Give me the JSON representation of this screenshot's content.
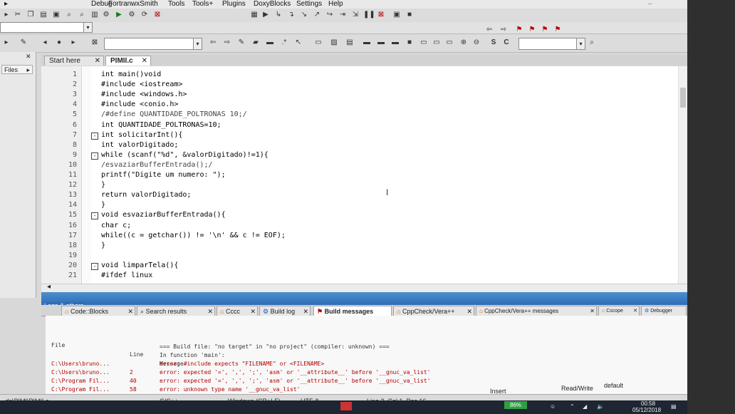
{
  "menu": [
    "Debug",
    "Fortran",
    "wxSmith",
    "Tools",
    "Tools+",
    "Plugins",
    "DoxyBlocks",
    "Settings",
    "Help"
  ],
  "left_panel": {
    "files_tab": "Files"
  },
  "editor_tabs": [
    {
      "label": "Start here",
      "active": false
    },
    {
      "label": "PIMII.c",
      "active": true
    }
  ],
  "code_lines": [
    {
      "n": "1",
      "text": "int main()void",
      "fold": ""
    },
    {
      "n": "2",
      "text": "#include <iostream>",
      "fold": ""
    },
    {
      "n": "3",
      "text": "#include <windows.h>",
      "fold": ""
    },
    {
      "n": "4",
      "text": "#include <conio.h>",
      "fold": ""
    },
    {
      "n": "5",
      "text": "/#define QUANTIDADE_POLTRONAS 10;/",
      "fold": ""
    },
    {
      "n": "6",
      "text": "int QUANTIDADE_POLTRONAS=10;",
      "fold": ""
    },
    {
      "n": "7",
      "text": "int solicitarInt(){",
      "fold": "-"
    },
    {
      "n": "8",
      "text": "int valorDigitado;",
      "fold": ""
    },
    {
      "n": "9",
      "text": "while (scanf(\"%d\", &valorDigitado)!=1){",
      "fold": "-"
    },
    {
      "n": "10",
      "text": "/esvaziarBufferEntrada();/",
      "fold": ""
    },
    {
      "n": "11",
      "text": "printf(\"Digite um numero: \");",
      "fold": ""
    },
    {
      "n": "12",
      "text": "}",
      "fold": ""
    },
    {
      "n": "13",
      "text": "return valorDigitado;",
      "fold": ""
    },
    {
      "n": "14",
      "text": "}",
      "fold": ""
    },
    {
      "n": "15",
      "text": "void esvaziarBufferEntrada(){",
      "fold": "-"
    },
    {
      "n": "16",
      "text": "char c;",
      "fold": ""
    },
    {
      "n": "17",
      "text": "while((c = getchar()) != '\\n' && c != EOF);",
      "fold": ""
    },
    {
      "n": "18",
      "text": "}",
      "fold": ""
    },
    {
      "n": "19",
      "text": "",
      "fold": ""
    },
    {
      "n": "20",
      "text": "void limparTela(){",
      "fold": "-"
    },
    {
      "n": "21",
      "text": "#ifdef linux",
      "fold": ""
    }
  ],
  "logs": {
    "title": "Logs & others",
    "tabs": [
      {
        "label": "Code::Blocks",
        "active": false
      },
      {
        "label": "Search results",
        "active": false
      },
      {
        "label": "Cccc",
        "active": false
      },
      {
        "label": "Build log",
        "active": false
      },
      {
        "label": "Build messages",
        "active": true
      },
      {
        "label": "CppCheck/Vera++",
        "active": false
      },
      {
        "label": "CppCheck/Vera++ messages",
        "active": false
      },
      {
        "label": "Cscope",
        "active": false
      },
      {
        "label": "Debugger",
        "active": false
      }
    ],
    "columns": [
      "File",
      "Line",
      "Message"
    ],
    "rows": [
      {
        "file": "",
        "line": "",
        "message": "=== Build file: \"no target\" in \"no project\" (compiler: unknown) ==="
      },
      {
        "file": "",
        "line": "",
        "message": "In function 'main':"
      },
      {
        "file": "C:\\Users\\bruno...",
        "line": "",
        "message": "error: #include expects \"FILENAME\" or <FILENAME>"
      },
      {
        "file": "C:\\Users\\bruno...",
        "line": "2",
        "message": "error: expected '=', ',', ';', 'asm' or '__attribute__' before '__gnuc_va_list'"
      },
      {
        "file": "C:\\Program Fil...",
        "line": "40",
        "message": "error: expected '=', ',', ';', 'asm' or '__attribute__' before '__gnuc_va_list'"
      },
      {
        "file": "C:\\Program Fil...",
        "line": "58",
        "message": "error: unknown type name '__gnuc_va_list'"
      }
    ]
  },
  "status": {
    "path": "...ds\\PIMI\\PIMII.c",
    "language": "C/C++",
    "eol": "Windows (CR+LF)",
    "encoding": "UTF-8",
    "position": "Line 2, Col 1, Pos 16",
    "mode": "Insert",
    "access": "Read/Write",
    "profile": "default"
  },
  "taskbar": {
    "battery": "86%",
    "time": "00:58",
    "date": "05/12/2018"
  }
}
